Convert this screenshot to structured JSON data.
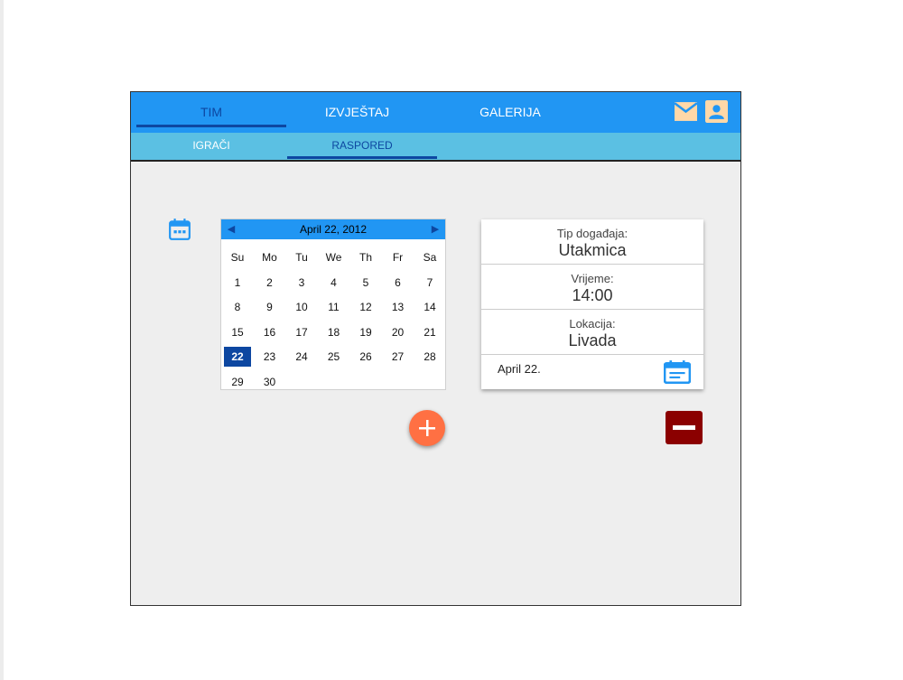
{
  "nav": {
    "tabs": [
      {
        "label": "TIM"
      },
      {
        "label": "IZVJEŠTAJ"
      },
      {
        "label": "GALERIJA"
      }
    ],
    "icons": [
      "mail-icon",
      "account-icon"
    ]
  },
  "subnav": {
    "tabs": [
      {
        "label": "IGRAČI"
      },
      {
        "label": "RASPORED"
      }
    ]
  },
  "calendar": {
    "title": "April 22, 2012",
    "prev": "◀",
    "next": "▶",
    "weekdays": [
      "Su",
      "Mo",
      "Tu",
      "We",
      "Th",
      "Fr",
      "Sa"
    ],
    "weeks": [
      [
        "1",
        "2",
        "3",
        "4",
        "5",
        "6",
        "7"
      ],
      [
        "8",
        "9",
        "10",
        "11",
        "12",
        "13",
        "14"
      ],
      [
        "15",
        "16",
        "17",
        "18",
        "19",
        "20",
        "21"
      ],
      [
        "22",
        "23",
        "24",
        "25",
        "26",
        "27",
        "28"
      ],
      [
        "29",
        "30",
        "",
        "",
        "",
        "",
        ""
      ]
    ],
    "selected_day": "22"
  },
  "event": {
    "type_label": "Tip događaja:",
    "type_value": "Utakmica",
    "time_label": "Vrijeme:",
    "time_value": "14:00",
    "location_label": "Lokacija:",
    "location_value": "Livada",
    "date": "April 22."
  },
  "colors": {
    "primary": "#2196f3",
    "secondary": "#5bc0e3",
    "accent_dark": "#0d47a1",
    "fab": "#ff7043",
    "danger": "#8b0000",
    "icon_peach": "#ffd8a8"
  }
}
